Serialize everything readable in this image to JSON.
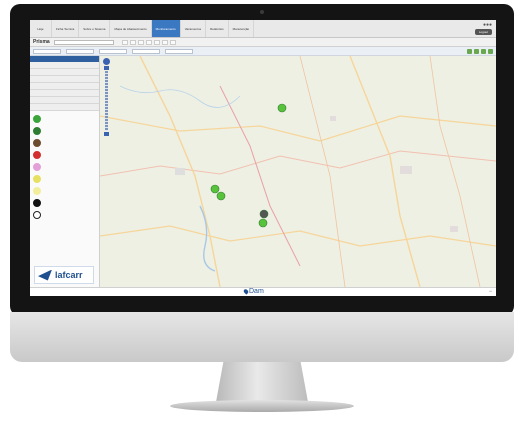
{
  "topnav": {
    "items": [
      {
        "label": "Hoje"
      },
      {
        "label": "Ficha Tecnica"
      },
      {
        "label": "Sobre o Sistema"
      },
      {
        "label": "Mapa de Abastecimento"
      },
      {
        "label": "Monitoramento",
        "active": true
      },
      {
        "label": "Vazamentos"
      },
      {
        "label": "Relatórios"
      },
      {
        "label": "Manutenção"
      }
    ],
    "logout_label": "Logout"
  },
  "toolbar": {
    "title": "Prisma"
  },
  "footer": {
    "brand": "Dam"
  },
  "branding": {
    "lafcarr": "lafcarr"
  },
  "legend": [
    {
      "color": "#3aa53a"
    },
    {
      "color": "#2e7d32"
    },
    {
      "color": "#6d4c2e"
    },
    {
      "color": "#d32f2f"
    },
    {
      "color": "#e3a0d8"
    },
    {
      "color": "#e8e060"
    },
    {
      "color": "#f2ee9c"
    },
    {
      "color": "#111111"
    },
    {
      "color": "#ffffff"
    }
  ],
  "map_markers": [
    {
      "color": "#58c23a"
    },
    {
      "color": "#58c23a"
    },
    {
      "color": "#58c23a"
    },
    {
      "color": "#555555"
    },
    {
      "color": "#58c23a"
    }
  ]
}
